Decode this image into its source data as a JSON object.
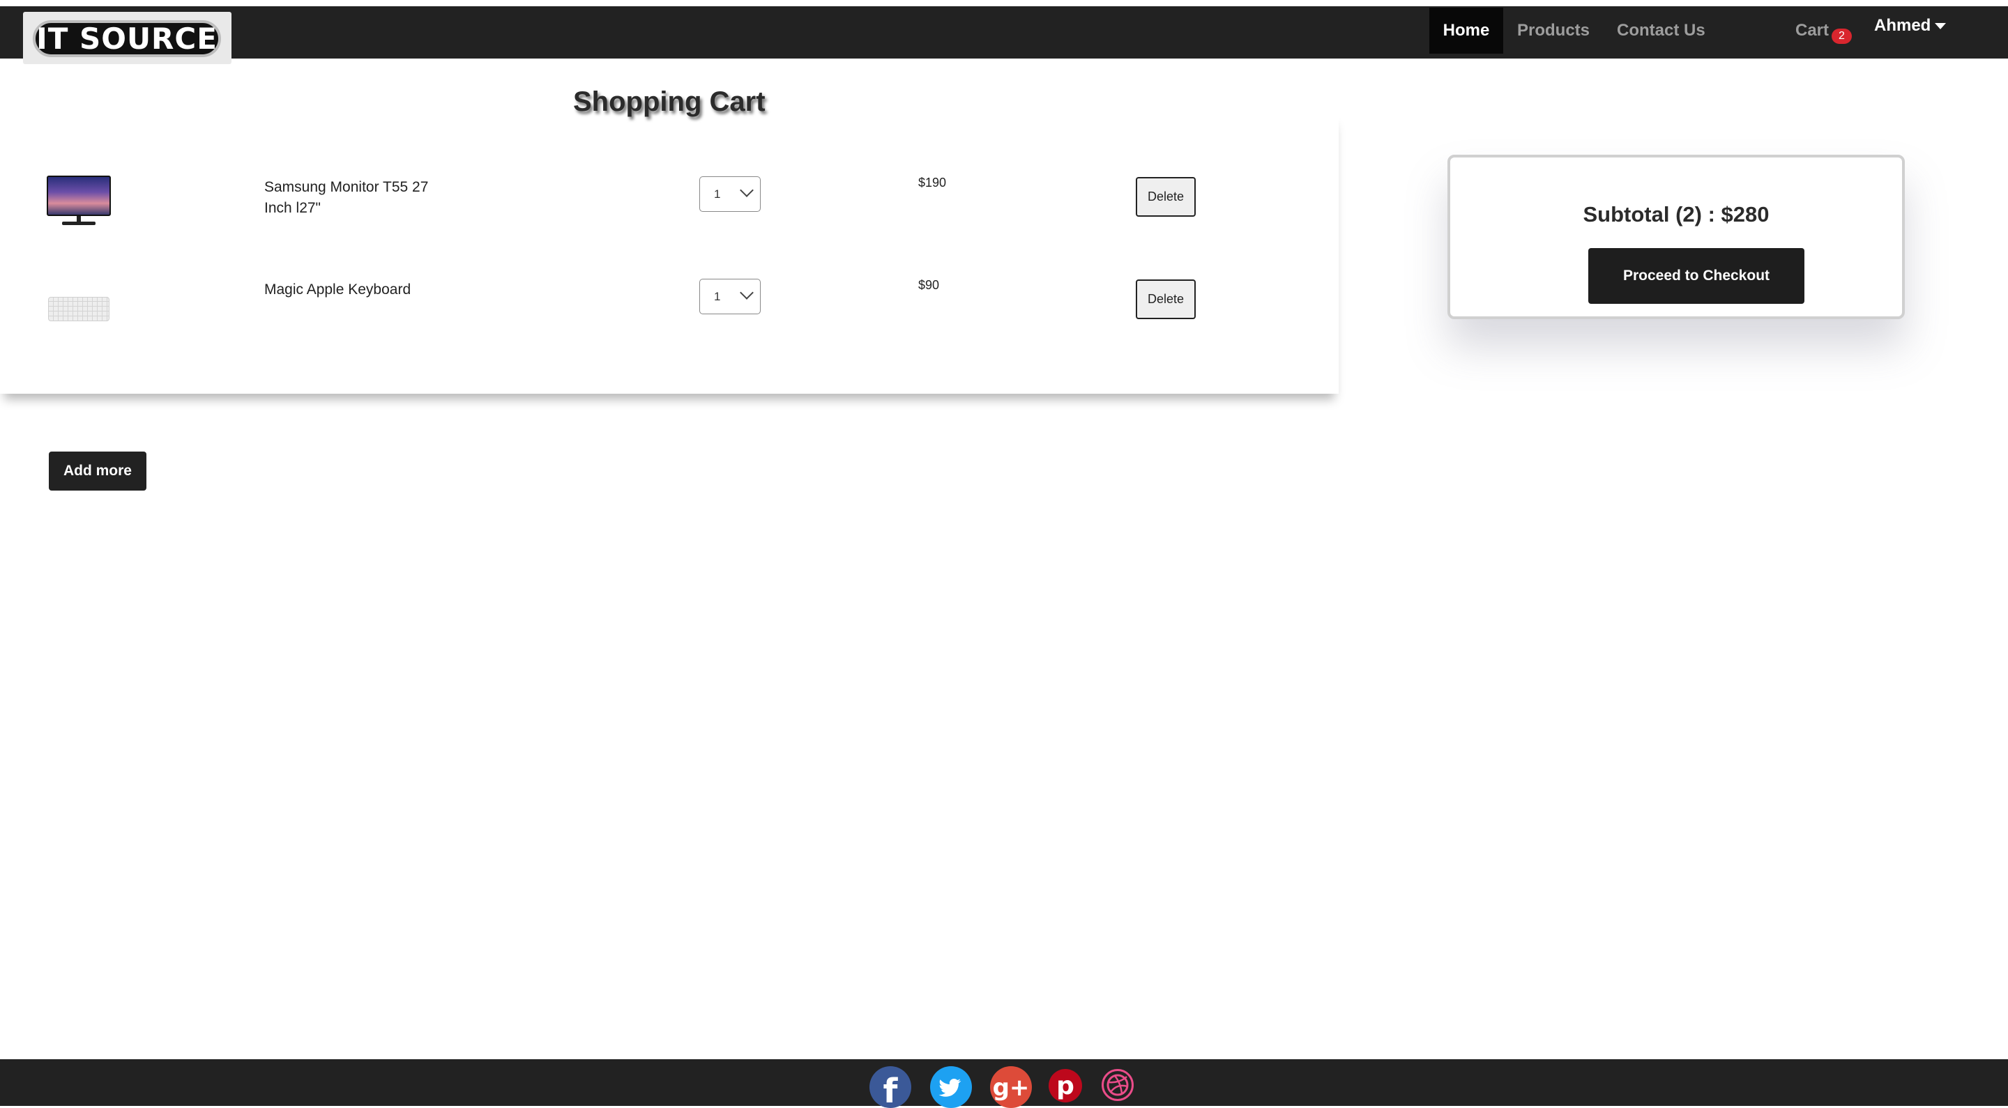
{
  "brand": {
    "logo_text": "IT SOURCE"
  },
  "nav": {
    "home": "Home",
    "products": "Products",
    "contact": "Contact Us",
    "cart": "Cart",
    "cart_count": "2",
    "user": "Ahmed"
  },
  "cart": {
    "title": "Shopping Cart",
    "items": [
      {
        "name": "Samsung Monitor T55 27 Inch l27\"",
        "qty": "1",
        "price": "$190",
        "delete_label": "Delete",
        "image": "monitor-image"
      },
      {
        "name": "Magic Apple Keyboard",
        "qty": "1",
        "price": "$90",
        "delete_label": "Delete",
        "image": "keyboard-image"
      }
    ],
    "add_more_label": "Add more"
  },
  "summary": {
    "subtotal": "Subtotal (2) : $280",
    "checkout_label": "Proceed to Checkout"
  },
  "footer": {
    "icons": [
      "facebook-icon",
      "twitter-icon",
      "google-plus-icon",
      "pinterest-icon",
      "dribbble-icon"
    ]
  },
  "colors": {
    "navbar": "#222222",
    "badge": "#d9262e",
    "button": "#222222"
  }
}
